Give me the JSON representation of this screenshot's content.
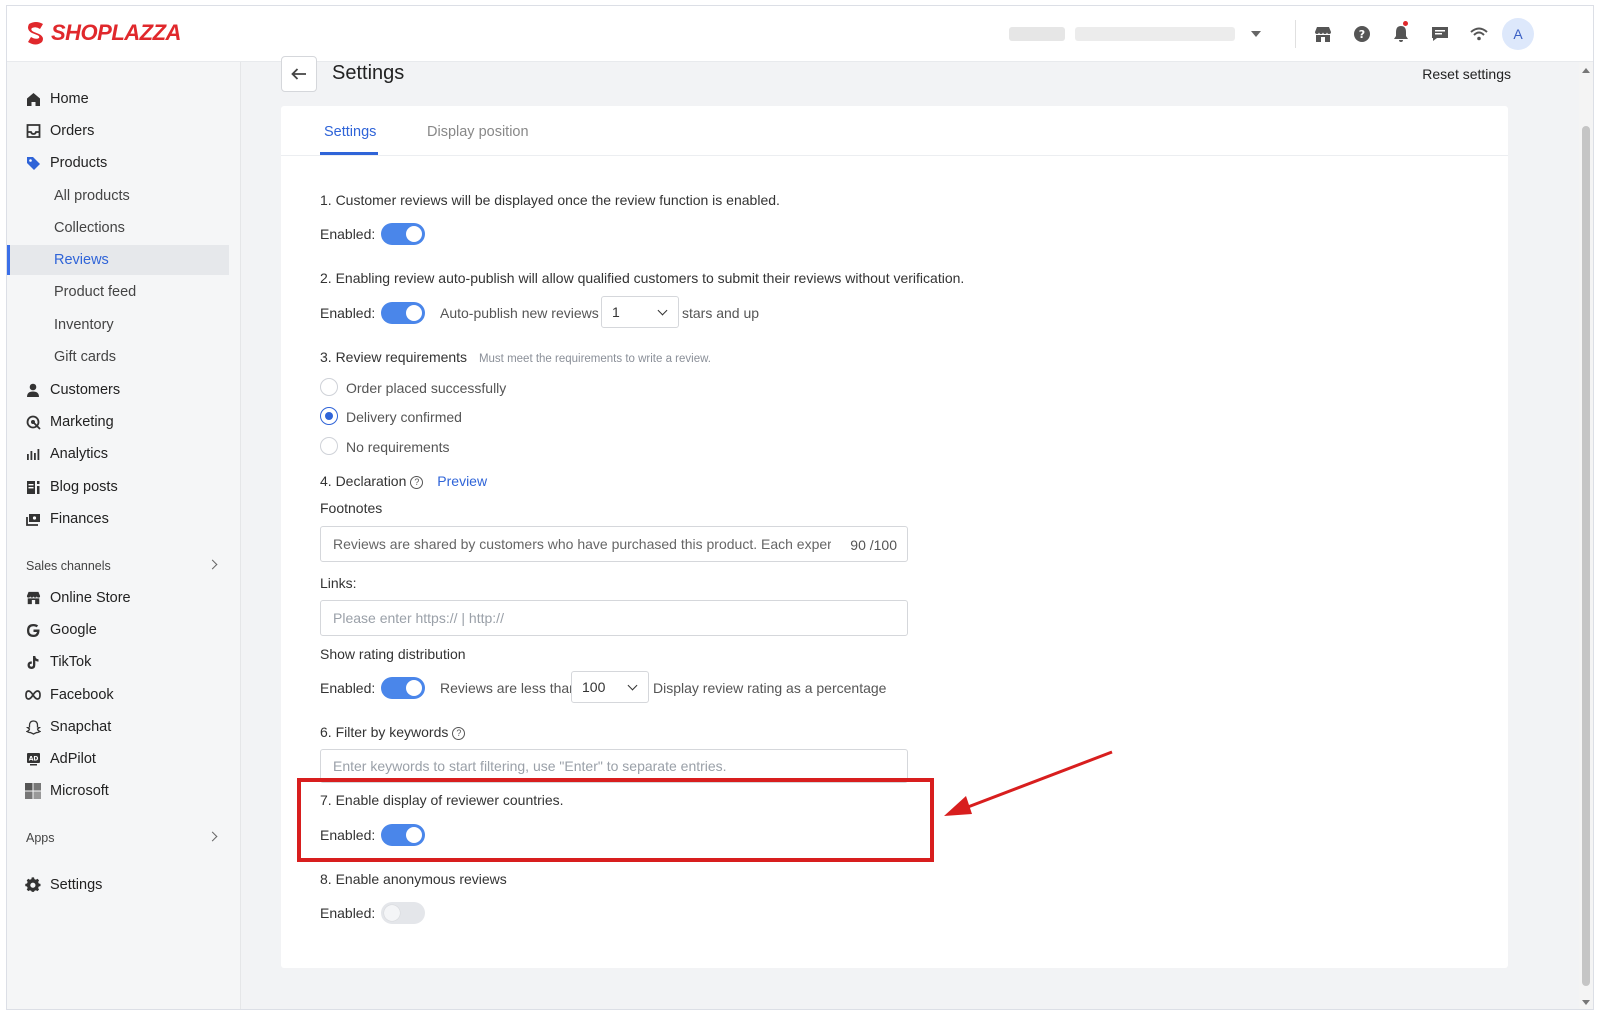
{
  "brand": {
    "name": "SHOPLAZZA",
    "color": "#e0282c",
    "accent": "#2f64d8"
  },
  "topbar": {
    "avatar_letter": "A",
    "icons": [
      "store-icon",
      "help-icon",
      "bell-icon",
      "chat-icon",
      "wifi-icon"
    ]
  },
  "sidebar": {
    "home": "Home",
    "orders": "Orders",
    "products": "Products",
    "all_products": "All products",
    "collections": "Collections",
    "reviews": "Reviews",
    "product_feed": "Product feed",
    "inventory": "Inventory",
    "gift_cards": "Gift cards",
    "customers": "Customers",
    "marketing": "Marketing",
    "analytics": "Analytics",
    "blog_posts": "Blog posts",
    "finances": "Finances",
    "sales_channels": "Sales channels",
    "online_store": "Online Store",
    "google": "Google",
    "tiktok": "TikTok",
    "facebook": "Facebook",
    "snapchat": "Snapchat",
    "adpilot": "AdPilot",
    "microsoft": "Microsoft",
    "apps": "Apps",
    "settings": "Settings"
  },
  "page": {
    "title": "Settings",
    "reset": "Reset settings"
  },
  "tabs": {
    "settings": "Settings",
    "display_position": "Display position"
  },
  "s1": {
    "text": "1. Customer reviews will be displayed once the review function is enabled.",
    "enabled_label": "Enabled:",
    "enabled": true
  },
  "s2": {
    "text": "2. Enabling review auto-publish will allow qualified customers to submit their reviews without verification.",
    "enabled_label": "Enabled:",
    "enabled": true,
    "auto_publish_label": "Auto-publish new reviews",
    "stars_value": "1",
    "stars_suffix": "stars and up"
  },
  "s3": {
    "title": "3. Review requirements",
    "hint": "Must meet the requirements to write a review.",
    "opt1": "Order placed successfully",
    "opt2": "Delivery confirmed",
    "opt3": "No requirements",
    "selected": "Delivery confirmed"
  },
  "s4": {
    "title": "4. Declaration",
    "preview": "Preview",
    "footnotes_label": "Footnotes",
    "footnotes_value": "Reviews are shared by customers who have purchased this product. Each experience",
    "footnotes_counter": "90 /100",
    "links_label": "Links:",
    "links_placeholder": "Please enter https:// | http://"
  },
  "s5": {
    "title": "Show rating distribution",
    "enabled_label": "Enabled:",
    "enabled": true,
    "less_than_label": "Reviews are less than",
    "less_than_value": "100",
    "suffix": "Display review rating as a percentage"
  },
  "s6": {
    "title": "6. Filter by keywords",
    "placeholder": "Enter keywords to start filtering, use \"Enter\" to separate entries."
  },
  "s7": {
    "title": "7. Enable display of reviewer countries.",
    "enabled_label": "Enabled:",
    "enabled": true
  },
  "s8": {
    "title": "8. Enable anonymous reviews",
    "enabled_label": "Enabled:",
    "enabled": false
  },
  "annotation": {
    "color": "#d81e1e"
  }
}
